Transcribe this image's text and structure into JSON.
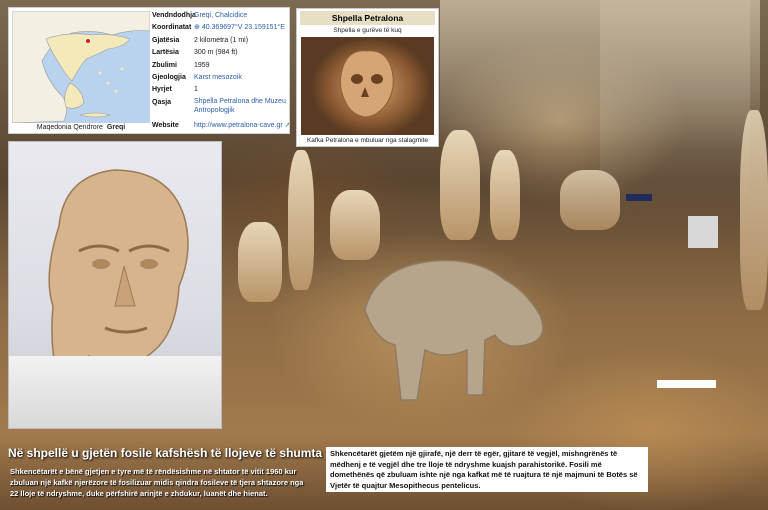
{
  "infobox": {
    "rows": [
      {
        "key": "Vendndodhja",
        "value": "Greqi, Chalcidice"
      },
      {
        "key": "Koordinatat",
        "value": "40.369697°V 23.159151°E"
      },
      {
        "key": "Gjatësia",
        "value": "2 kilometra (1 mi)"
      },
      {
        "key": "Lartësia",
        "value": "300 m (984 ft)"
      },
      {
        "key": "Zbulimi",
        "value": "1959"
      },
      {
        "key": "Gjeologjia",
        "value": "Karst mesozoik"
      },
      {
        "key": "Hyrjet",
        "value": "1"
      },
      {
        "key": "Qasja",
        "value": "Shpella Petralona dhe Muzeu Antropologjik"
      },
      {
        "key": "Website",
        "value": "http://www.petralona-cave.gr"
      }
    ],
    "map_caption": "Maqedonia Qendrore",
    "map_caption_bold": "Greqi"
  },
  "shpella": {
    "title": "Shpella Petralona",
    "subtitle": "Shpella e gurëve të kuq",
    "photo_caption": "Kafka Petralona e mbuluar nga stalagmite"
  },
  "heading": "Në shpellë u gjetën fosile kafshësh të llojeve të shumta :",
  "paragraph_left": "Shkencëtarët e bënë gjetjen e tyre më të rëndësishme në shtator të vitit 1960 kur zbuluan një kafkë njerëzore të fosilizuar midis qindra fosileve të tjera shtazore nga 22 lloje të ndryshme, duke përfshirë arinjtë e zhdukur, luanët dhe hienat.",
  "paragraph_right": "Shkencëtarët gjetëm një gjirafë, një derr të egër, gjitarë të vegjël, mishngrënës të mëdhenj e të vegjël dhe tre lloje të ndryshme kuajsh parahistorikë. Fosili më domethënës që zbuluam ishte një nga kafkat më të ruajtura të një majmuni të Botës së Vjetër të quajtur Mesopithecus pentelicus.",
  "colors": {
    "link": "#2a5db0",
    "title_bg": "#e7dfc4"
  }
}
